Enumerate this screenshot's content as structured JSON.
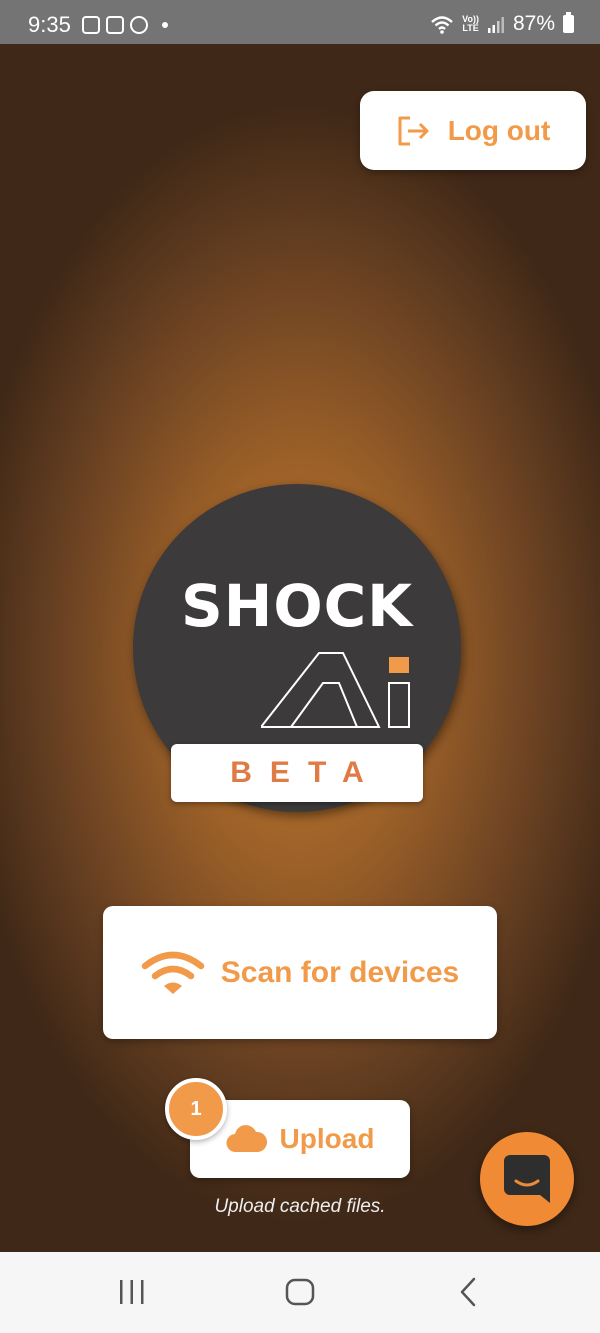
{
  "status_bar": {
    "time": "9:35",
    "volte_line1": "Vo))",
    "volte_line2": "LTE",
    "battery": "87%"
  },
  "header": {
    "logout_label": "Log out"
  },
  "logo": {
    "brand": "SHOCK",
    "badge": "BETA"
  },
  "actions": {
    "scan_label": "Scan for devices",
    "upload_label": "Upload",
    "upload_count": "1",
    "upload_hint": "Upload cached files."
  },
  "colors": {
    "accent": "#f19a4a",
    "chat": "#f18a35",
    "logo_bg": "#3c3a3a",
    "beta": "#e07b45"
  },
  "icons": [
    "logout-icon",
    "wifi-icon",
    "cloud-icon",
    "chat-icon",
    "recent-apps-icon",
    "home-icon",
    "back-icon"
  ]
}
